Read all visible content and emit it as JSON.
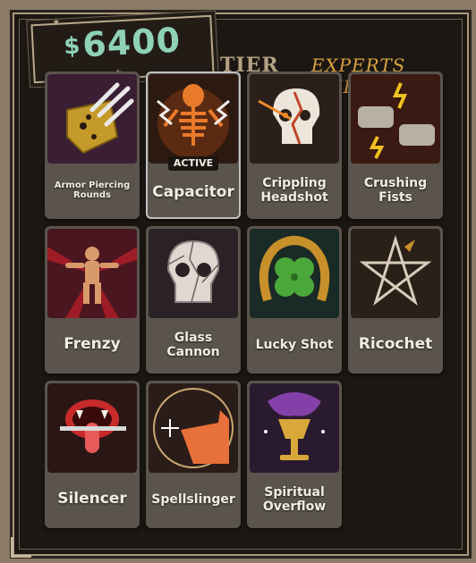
{
  "money": {
    "currency": "$",
    "amount": "6400"
  },
  "tier": {
    "label": "TIER 4",
    "subtitle": "EXPERTS ONLY"
  },
  "cards": [
    {
      "label": "Armor Piercing Rounds",
      "icon": "bullet-shield-icon"
    },
    {
      "label": "Capacitor",
      "icon": "electric-skeleton-icon",
      "badge": "ACTIVE"
    },
    {
      "label": "Crippling Headshot",
      "icon": "cracked-skull-icon"
    },
    {
      "label": "Crushing Fists",
      "icon": "gauntlet-fists-icon"
    },
    {
      "label": "Frenzy",
      "icon": "frenzied-man-icon"
    },
    {
      "label": "Glass Cannon",
      "icon": "shattered-skull-icon"
    },
    {
      "label": "Lucky Shot",
      "icon": "horseshoe-clover-icon"
    },
    {
      "label": "Ricochet",
      "icon": "pentagram-bullet-icon"
    },
    {
      "label": "Silencer",
      "icon": "mouth-dagger-icon"
    },
    {
      "label": "Spellslinger",
      "icon": "finger-gun-icon"
    },
    {
      "label": "Spiritual Overflow",
      "icon": "chalice-icon"
    }
  ],
  "colors": {
    "money": "#8fd2b6",
    "tier": "#b3a182",
    "experts": "#d8a23e",
    "card_bg": "#5a544d"
  }
}
